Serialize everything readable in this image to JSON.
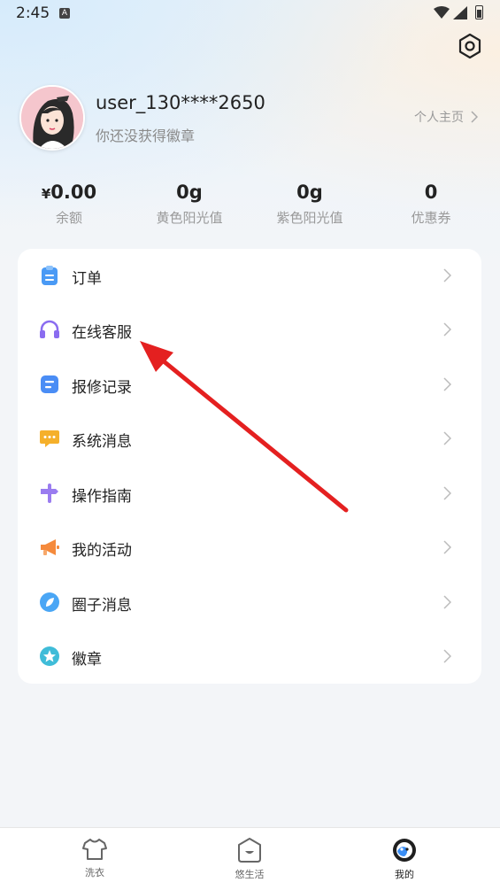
{
  "status_bar": {
    "time": "2:45",
    "notification_icon": "A"
  },
  "profile": {
    "username": "user_130****2650",
    "badge_text": "你还没获得徽章",
    "homepage_label": "个人主页"
  },
  "stats": [
    {
      "currency": "¥",
      "value": "0.00",
      "label": "余额"
    },
    {
      "currency": "",
      "value": "0g",
      "label": "黄色阳光值"
    },
    {
      "currency": "",
      "value": "0g",
      "label": "紫色阳光值"
    },
    {
      "currency": "",
      "value": "0",
      "label": "优惠券"
    }
  ],
  "menu": [
    {
      "label": "订单",
      "icon": "clipboard-icon",
      "color": "#4a9af5"
    },
    {
      "label": "在线客服",
      "icon": "headset-icon",
      "color": "#8a6cf0"
    },
    {
      "label": "报修记录",
      "icon": "record-icon",
      "color": "#4a8df5"
    },
    {
      "label": "系统消息",
      "icon": "chat-bubble-icon",
      "color": "#f5b02b"
    },
    {
      "label": "操作指南",
      "icon": "signpost-icon",
      "color": "#9a7cf0"
    },
    {
      "label": "我的活动",
      "icon": "megaphone-icon",
      "color": "#f58a3c"
    },
    {
      "label": "圈子消息",
      "icon": "leaf-circle-icon",
      "color": "#4aa6f5"
    },
    {
      "label": "徽章",
      "icon": "star-badge-icon",
      "color": "#3fbcd8"
    }
  ],
  "tabbar": [
    {
      "label": "洗衣",
      "icon": "shirt-icon",
      "active": false
    },
    {
      "label": "悠生活",
      "icon": "home-smile-icon",
      "active": false
    },
    {
      "label": "我的",
      "icon": "profile-face-icon",
      "active": true
    }
  ],
  "colors": {
    "annotation_arrow": "#e42020"
  }
}
